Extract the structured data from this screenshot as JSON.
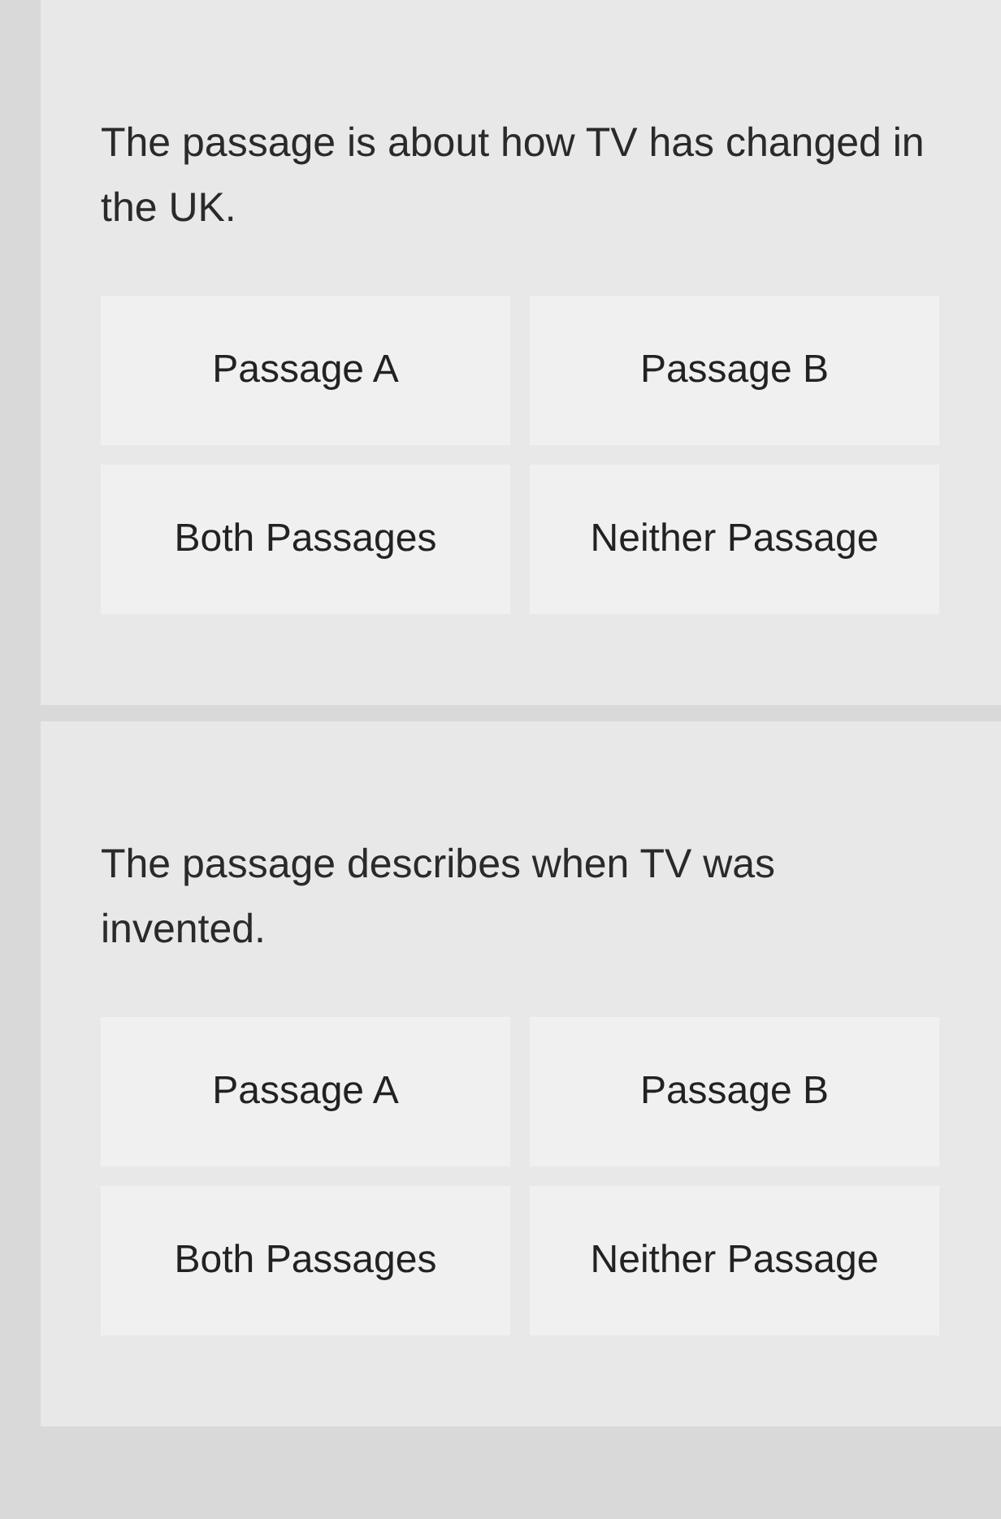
{
  "questions": [
    {
      "prompt": "The passage is about how TV has changed in the UK.",
      "options": [
        {
          "label": "Passage A",
          "selected": false
        },
        {
          "label": "Passage B",
          "selected": false
        },
        {
          "label": "Both Passages",
          "selected": false
        },
        {
          "label": "Neither Passage",
          "selected": false
        }
      ]
    },
    {
      "prompt": "The passage describes when TV was invented.",
      "options": [
        {
          "label": "Passage A",
          "selected": false
        },
        {
          "label": "Passage B",
          "selected": false
        },
        {
          "label": "Both Passages",
          "selected": false
        },
        {
          "label": "Neither Passage",
          "selected": false
        }
      ]
    }
  ]
}
